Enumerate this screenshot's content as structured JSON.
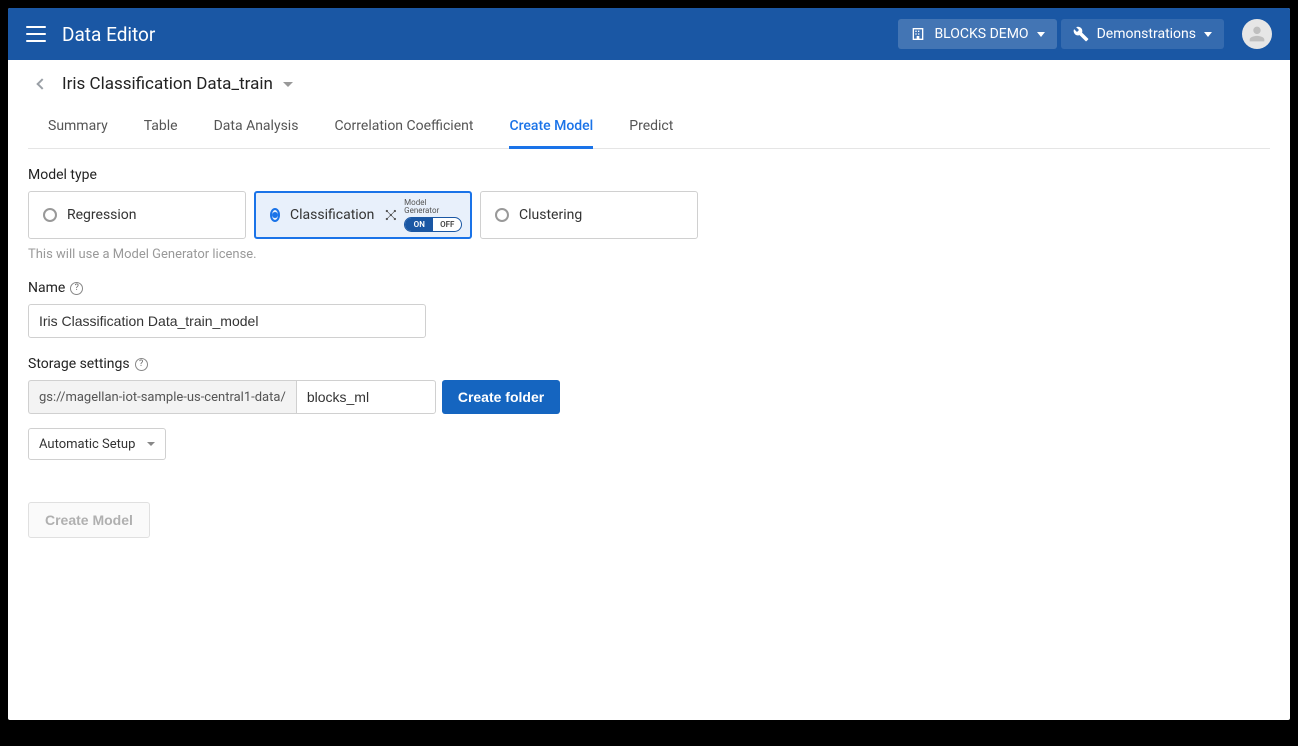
{
  "header": {
    "title": "Data Editor",
    "projectButton": "BLOCKS DEMO",
    "demosButton": "Demonstrations"
  },
  "breadcrumb": {
    "title": "Iris Classification Data_train"
  },
  "tabs": [
    {
      "label": "Summary"
    },
    {
      "label": "Table"
    },
    {
      "label": "Data Analysis"
    },
    {
      "label": "Correlation Coefficient"
    },
    {
      "label": "Create Model"
    },
    {
      "label": "Predict"
    }
  ],
  "modelType": {
    "label": "Model type",
    "options": {
      "regression": "Regression",
      "classification": "Classification",
      "clustering": "Clustering"
    },
    "mgLabel": "Model Generator",
    "toggleOn": "ON",
    "toggleOff": "OFF",
    "helper": "This will use a Model Generator license."
  },
  "nameField": {
    "label": "Name",
    "value": "Iris Classification Data_train_model"
  },
  "storage": {
    "label": "Storage settings",
    "prefix": "gs://magellan-iot-sample-us-central1-data/",
    "folder": "blocks_ml",
    "createFolderBtn": "Create folder",
    "setupSelect": "Automatic Setup"
  },
  "createModelBtn": "Create Model"
}
